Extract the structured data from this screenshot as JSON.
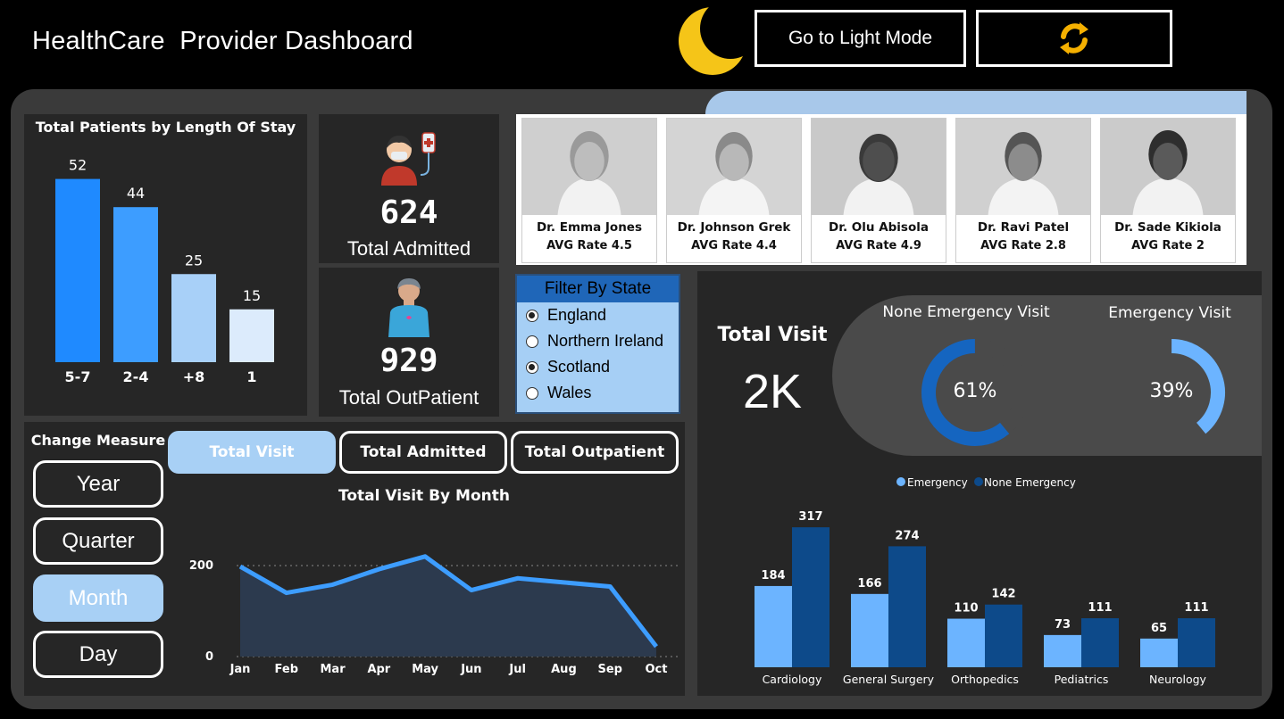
{
  "header": {
    "title": "HealthCare  Provider Dashboard",
    "light_mode_label": "Go to Light Mode"
  },
  "icons": {
    "theme": "moon-icon",
    "refresh": "refresh-icon",
    "admitted": "patient-drip-icon",
    "outpatient": "outpatient-icon"
  },
  "colors": {
    "accent": "#1f8aff",
    "light_blue": "#a8d0f5",
    "navy": "#0d4a8a",
    "sky": "#6cb4ff",
    "moon": "#f5c518"
  },
  "length_of_stay": {
    "title": "Total Patients by Length Of Stay",
    "bars": [
      {
        "label": "5-7",
        "value": 52,
        "color": "#1f8aff"
      },
      {
        "label": "2-4",
        "value": 44,
        "color": "#3d9dff"
      },
      {
        "label": "+8",
        "value": 25,
        "color": "#a8d0f8"
      },
      {
        "label": "1",
        "value": 15,
        "color": "#dcebfc"
      }
    ]
  },
  "kpis": {
    "admitted": {
      "value": "624",
      "label": "Total Admitted"
    },
    "outpatient": {
      "value": "929",
      "label": "Total OutPatient"
    }
  },
  "doctors": [
    {
      "name": "Dr. Emma Jones",
      "rate": "AVG Rate 4.5"
    },
    {
      "name": "Dr. Johnson Grek",
      "rate": "AVG Rate 4.4"
    },
    {
      "name": "Dr. Olu Abisola",
      "rate": "AVG Rate 4.9"
    },
    {
      "name": "Dr. Ravi Patel",
      "rate": "AVG Rate 2.8"
    },
    {
      "name": "Dr. Sade Kikiola",
      "rate": "AVG Rate 2"
    }
  ],
  "filter": {
    "title": "Filter By State",
    "options": [
      {
        "label": "England",
        "selected": true
      },
      {
        "label": "Northern Ireland",
        "selected": false
      },
      {
        "label": "Scotland",
        "selected": true
      },
      {
        "label": "Wales",
        "selected": false
      }
    ]
  },
  "measure": {
    "title": "Change Measure",
    "options": [
      "Year",
      "Quarter",
      "Month",
      "Day"
    ],
    "active": "Month"
  },
  "metric_tabs": {
    "options": [
      "Total Visit",
      "Total Admitted",
      "Total Outpatient"
    ],
    "active": "Total Visit"
  },
  "visits": {
    "title": "Total Visit",
    "value": "2K",
    "non_emergency_label": "None Emergency Visit",
    "non_emergency_pct": "61%",
    "emergency_label": "Emergency Visit",
    "emergency_pct": "39%"
  },
  "chart_data": [
    {
      "type": "line",
      "title": "Total Visit By Month",
      "x": [
        "Jan",
        "Feb",
        "Mar",
        "Apr",
        "May",
        "Jun",
        "Jul",
        "Aug",
        "Sep",
        "Oct"
      ],
      "values": [
        198,
        140,
        158,
        192,
        220,
        146,
        172,
        163,
        154,
        22
      ],
      "ylim": [
        0,
        200
      ],
      "yticks": [
        "0",
        "200"
      ]
    },
    {
      "type": "bar",
      "title": "",
      "categories": [
        "Cardiology",
        "General Surgery",
        "Orthopedics",
        "Pediatrics",
        "Neurology"
      ],
      "series": [
        {
          "name": "Emergency",
          "values": [
            184,
            166,
            110,
            73,
            65
          ],
          "color": "#6cb4ff"
        },
        {
          "name": "None Emergency",
          "values": [
            317,
            274,
            142,
            111,
            111
          ],
          "color": "#0d4a8a"
        }
      ],
      "legend": "top"
    }
  ]
}
